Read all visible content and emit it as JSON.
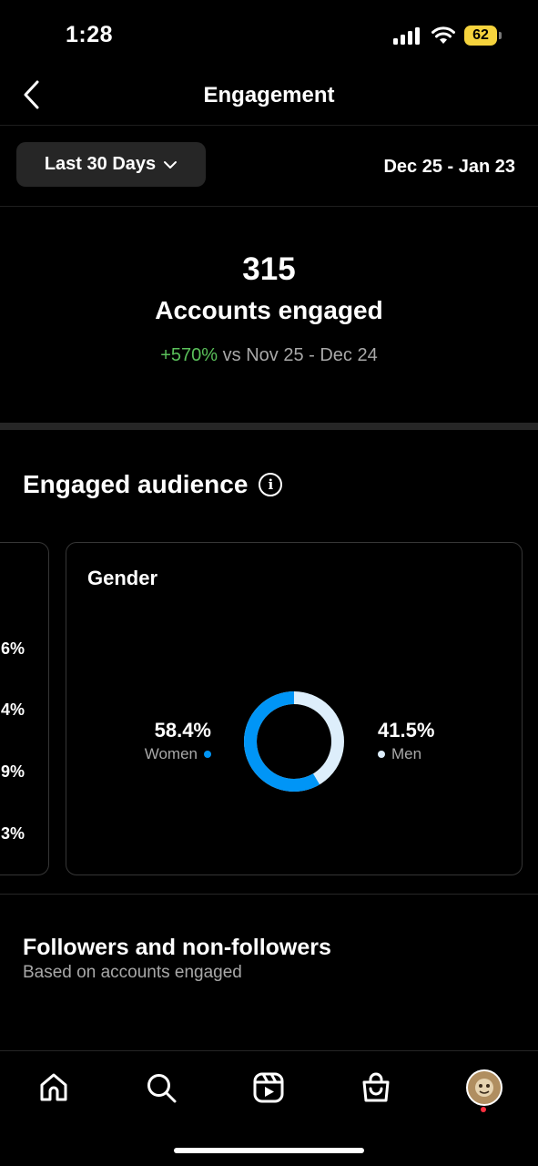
{
  "status_bar": {
    "time": "1:28",
    "battery": "62"
  },
  "header": {
    "title": "Engagement"
  },
  "filter": {
    "range_label": "Last 30 Days",
    "date_range": "Dec 25 - Jan 23"
  },
  "summary": {
    "count": "315",
    "label": "Accounts engaged",
    "change_pct": "+570%",
    "change_text": "vs Nov 25 - Dec 24"
  },
  "engaged_audience": {
    "title": "Engaged audience",
    "left_card_values": [
      "6%",
      "4%",
      "9%",
      "3%"
    ],
    "gender": {
      "title": "Gender",
      "women": {
        "pct": "58.4%",
        "label": "Women",
        "value": 58.4,
        "color": "#0095f6"
      },
      "men": {
        "pct": "41.5%",
        "label": "Men",
        "value": 41.5,
        "color": "#ddeefb"
      }
    }
  },
  "followers": {
    "title": "Followers and non-followers",
    "subtitle": "Based on accounts engaged"
  },
  "nav": {
    "items": [
      "home-icon",
      "search-icon",
      "reels-icon",
      "shop-icon",
      "profile-avatar"
    ]
  }
}
